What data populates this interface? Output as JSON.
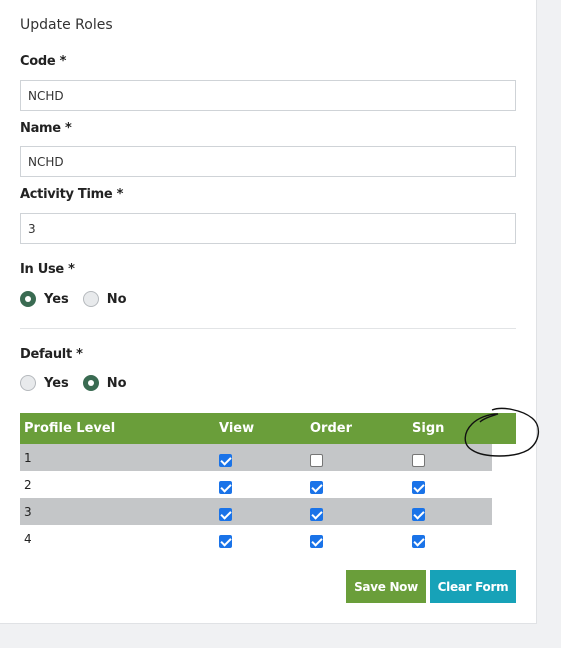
{
  "form": {
    "title": "Update Roles",
    "code": {
      "label": "Code *",
      "value": "NCHD"
    },
    "name": {
      "label": "Name *",
      "value": "NCHD"
    },
    "activity_time": {
      "label": "Activity Time *",
      "value": "3"
    },
    "in_use": {
      "label": "In Use *",
      "options": [
        "Yes",
        "No"
      ],
      "selected": "Yes"
    },
    "default": {
      "label": "Default *",
      "options": [
        "Yes",
        "No"
      ],
      "selected": "No"
    }
  },
  "table": {
    "headers": [
      "Profile Level",
      "View",
      "Order",
      "Sign"
    ],
    "rows": [
      {
        "level": "1",
        "view": true,
        "order": false,
        "sign": false
      },
      {
        "level": "2",
        "view": true,
        "order": true,
        "sign": true
      },
      {
        "level": "3",
        "view": true,
        "order": true,
        "sign": true
      },
      {
        "level": "4",
        "view": true,
        "order": true,
        "sign": true
      }
    ]
  },
  "buttons": {
    "save": "Save Now",
    "clear": "Clear Form"
  },
  "colors": {
    "header_green": "#6a9e3a",
    "radio_selected": "#3a6b52",
    "clear_button": "#17a2b8",
    "checkbox_checked": "#1a73e8"
  }
}
